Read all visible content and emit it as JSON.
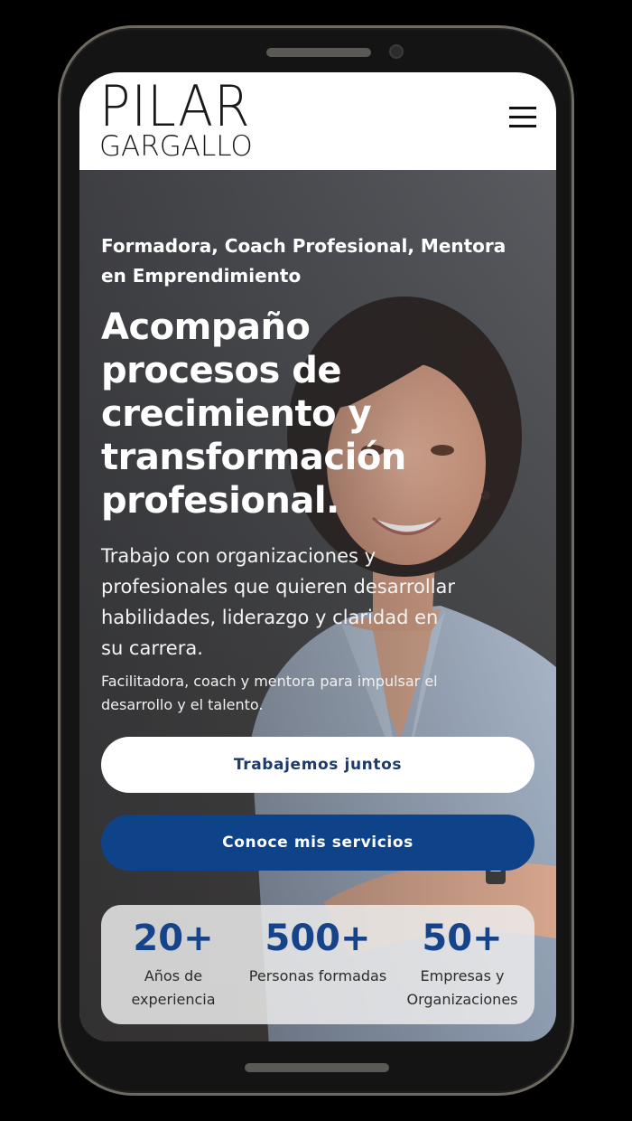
{
  "header": {
    "logo_line1": "PILAR",
    "logo_line2": "GARGALLO",
    "menu_icon": "hamburger-menu-icon"
  },
  "hero": {
    "subtitle": "Formadora, Coach Profesional, Mentora en Emprendimiento",
    "headline": "Acompaño procesos de crecimiento y transformación profesional.",
    "lead": "Trabajo con organizaciones y profesionales que quieren desarrollar habilidades, liderazgo y claridad en su carrera.",
    "small": "Facilitadora, coach y mentora para impulsar el desarrollo y el talento.",
    "cta_primary": "Trabajemos juntos",
    "cta_secondary": "Conoce mis servicios",
    "image": "portrait-photo"
  },
  "stats": [
    {
      "value": "20+",
      "label": "Años de experiencia"
    },
    {
      "value": "500+",
      "label": "Personas formadas"
    },
    {
      "value": "50+",
      "label": "Empresas y Organizaciones"
    }
  ],
  "colors": {
    "brand_blue": "#0f4389",
    "stat_blue": "#16438a",
    "header_bg": "#ffffff",
    "device_bezel": "#141414"
  }
}
